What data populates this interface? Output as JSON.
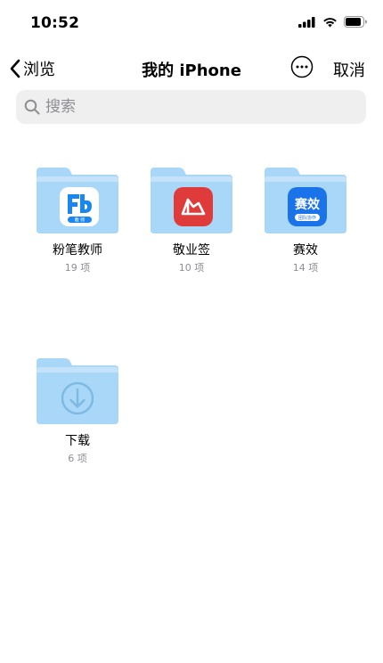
{
  "status": {
    "time": "10:52"
  },
  "nav": {
    "back_label": "浏览",
    "title": "我的 iPhone",
    "cancel_label": "取消"
  },
  "search": {
    "placeholder": "搜索"
  },
  "items": [
    {
      "name": "粉笔教师",
      "count": "19 项",
      "icon": "fenbi-app-icon",
      "icon_badge": "教 师"
    },
    {
      "name": "敬业签",
      "count": "10 项",
      "icon": "jingyeqian-app-icon"
    },
    {
      "name": "赛效",
      "count": "14 项",
      "icon": "saixiao-app-icon",
      "icon_text": "赛效",
      "icon_sub": "团队协作"
    },
    {
      "name": "下载",
      "count": "6 项",
      "icon": "download-icon"
    }
  ],
  "colors": {
    "folder": "#a9d7f7",
    "folder_tab": "#c4e3fa",
    "accent": "#1a86f0"
  }
}
